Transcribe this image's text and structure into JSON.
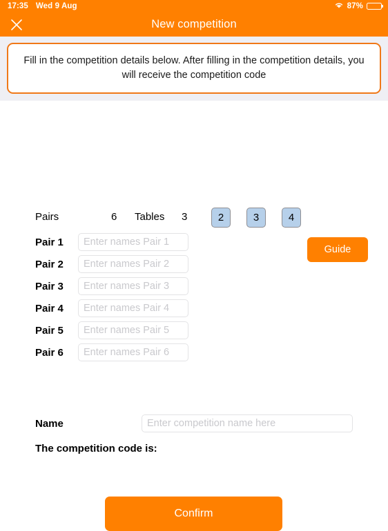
{
  "statusbar": {
    "time": "17:35",
    "date": "Wed 9 Aug",
    "wifi_icon": "wifi-icon",
    "battery_percent": "87%",
    "battery_icon": "battery-icon"
  },
  "navbar": {
    "close_icon": "close-icon",
    "title": "New competition"
  },
  "banner": {
    "text": "Fill in the competition details below. After filling in the competition details, you will receive the competition code"
  },
  "counts": {
    "pairs_label": "Pairs",
    "pairs_value": "6",
    "tables_label": "Tables",
    "tables_value": "3"
  },
  "table_size_buttons": [
    {
      "label": "2"
    },
    {
      "label": "3"
    },
    {
      "label": "4"
    }
  ],
  "pairs": [
    {
      "label": "Pair 1",
      "value": "",
      "placeholder": "Enter names Pair 1"
    },
    {
      "label": "Pair 2",
      "value": "",
      "placeholder": "Enter names Pair 2"
    },
    {
      "label": "Pair 3",
      "value": "",
      "placeholder": "Enter names Pair 3"
    },
    {
      "label": "Pair 4",
      "value": "",
      "placeholder": "Enter names Pair 4"
    },
    {
      "label": "Pair 5",
      "value": "",
      "placeholder": "Enter names Pair 5"
    },
    {
      "label": "Pair 6",
      "value": "",
      "placeholder": "Enter names Pair 6"
    }
  ],
  "guide": {
    "label": "Guide"
  },
  "name_field": {
    "label": "Name",
    "value": "",
    "placeholder": "Enter competition name here"
  },
  "competition_code": {
    "label": "The competition code is:",
    "value": ""
  },
  "confirm": {
    "label": "Confirm"
  },
  "colors": {
    "accent_orange": "#FF8000",
    "banner_border": "#F07818",
    "panel_gray": "#efeff4",
    "num_button_blue": "#b6d0ea",
    "num_button_border": "#8e8e93",
    "input_border": "#e3e3e5",
    "placeholder_gray": "#c9c9cd"
  }
}
